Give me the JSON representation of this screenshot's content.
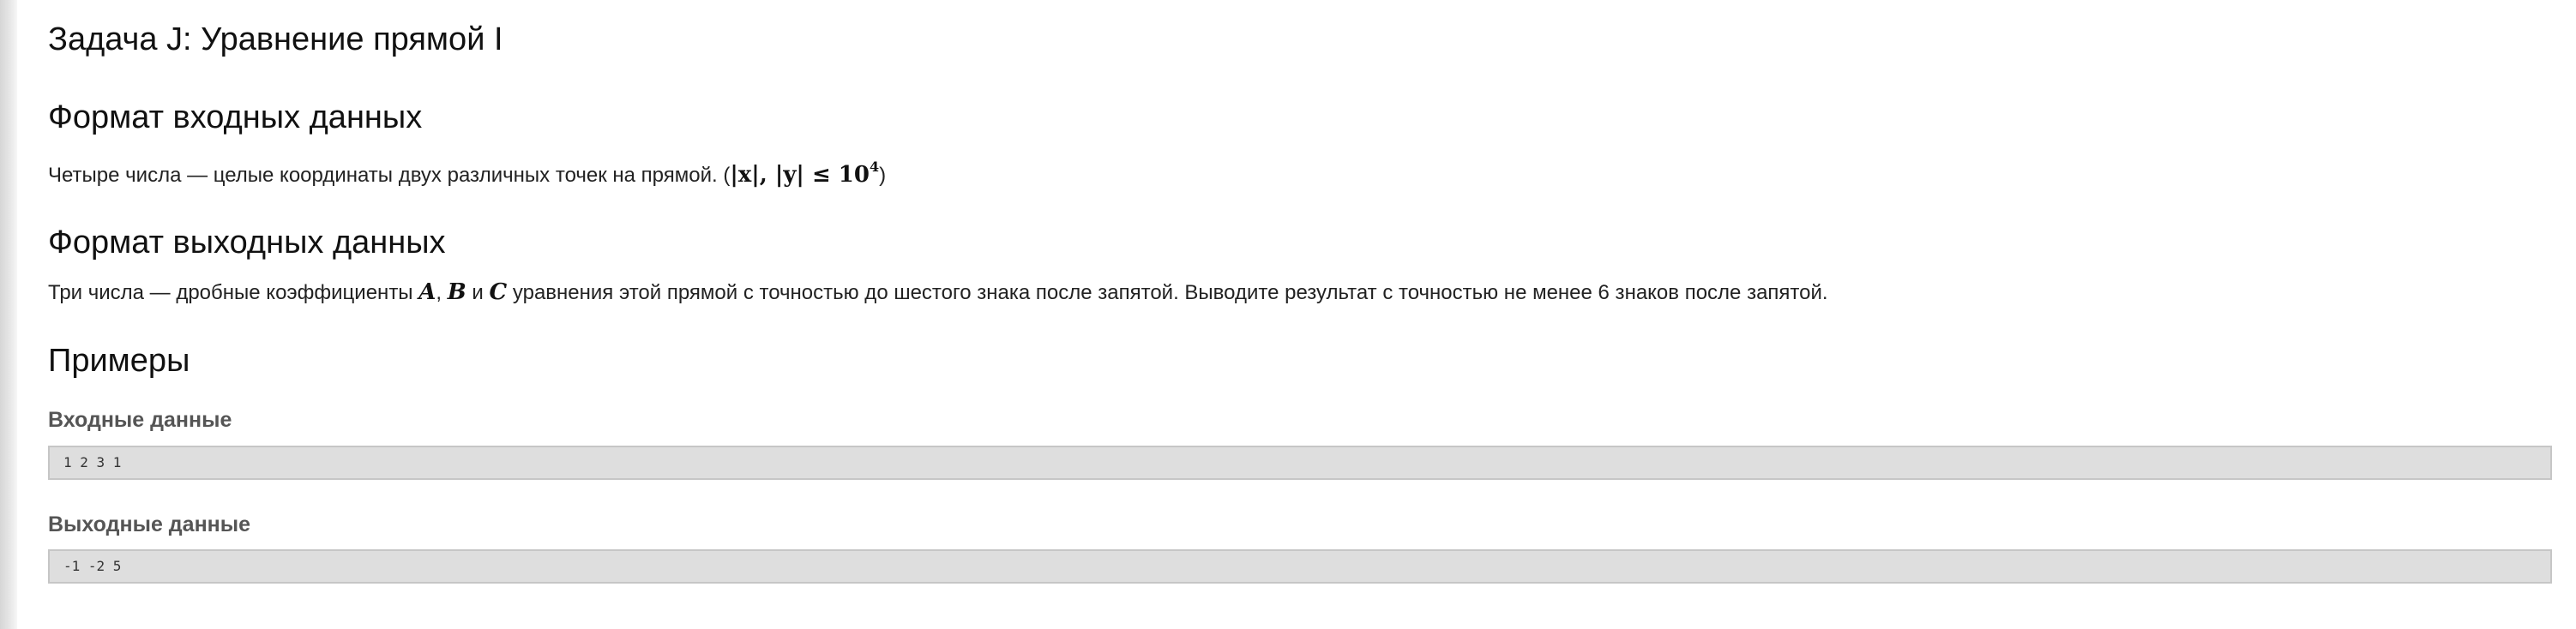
{
  "problem": {
    "title": "Задача J: Уравнение прямой I"
  },
  "input_format": {
    "heading": "Формат входных данных",
    "text_before_math": "Четыре числа — целые координаты двух различных точек на прямой. (",
    "math_abs_x": "|x|",
    "math_separator": ", ",
    "math_abs_y": "|y|",
    "math_leq": " ≤ ",
    "math_base": "10",
    "math_exponent": "4",
    "text_after_math": ")"
  },
  "output_format": {
    "heading": "Формат выходных данных",
    "text_before_math": "Три числа — дробные коэффициенты ",
    "var_a": "A",
    "comma_1": ", ",
    "var_b": "B",
    "conjunction": " и ",
    "var_c": "C",
    "text_after_math": " уравнения этой прямой с точностью до шестого знака после запятой. Выводите результат с точностью не менее 6 знаков после запятой."
  },
  "examples": {
    "heading": "Примеры",
    "input_label": "Входные данные",
    "input_value": "1 2 3 1",
    "output_label": "Выходные данные",
    "output_value": "-1 -2 5"
  }
}
